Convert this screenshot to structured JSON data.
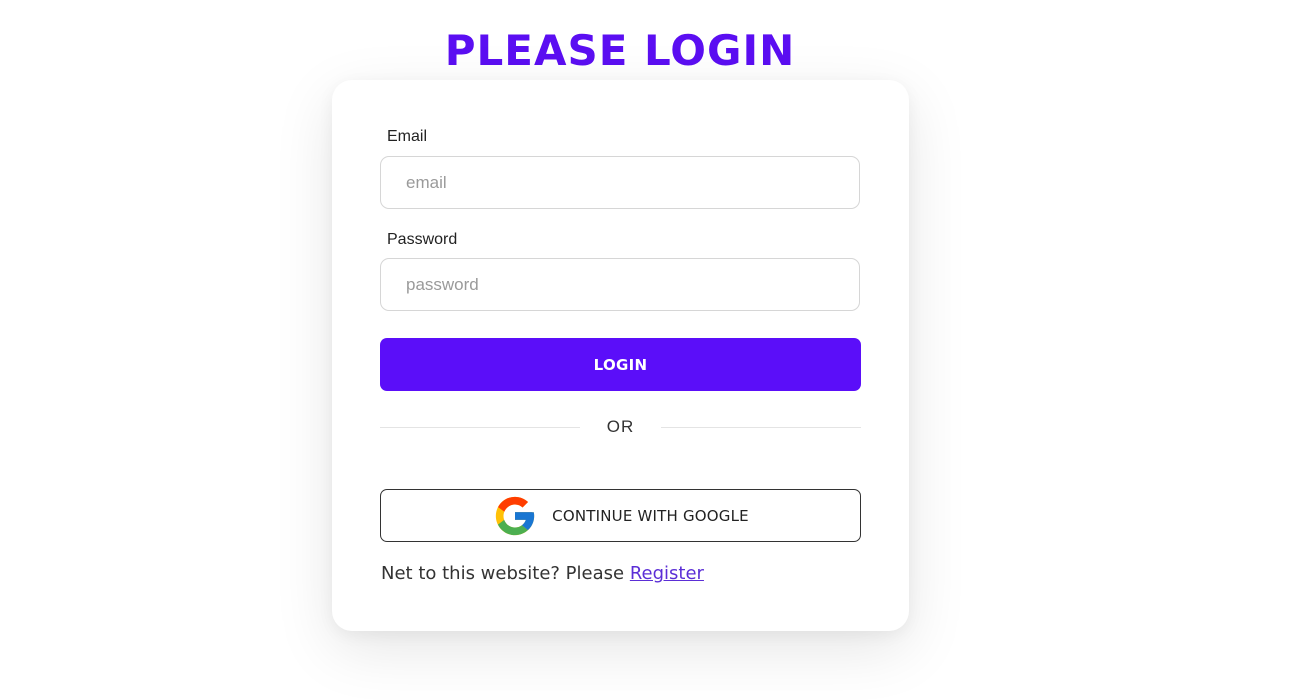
{
  "page": {
    "title": "PLEASE LOGIN"
  },
  "form": {
    "email_label": "Email",
    "email_placeholder": "email",
    "password_label": "Password",
    "password_placeholder": "password",
    "login_label": "LOGIN",
    "divider_text": "OR",
    "google_label": "CONTINUE WITH GOOGLE",
    "google_icon": "google-g-icon",
    "register_prompt": "Net to this website? Please",
    "register_link": "Register"
  },
  "colors": {
    "accent": "#5b0ef9",
    "title": "#5b0ef2",
    "link": "#5b2ed6"
  }
}
